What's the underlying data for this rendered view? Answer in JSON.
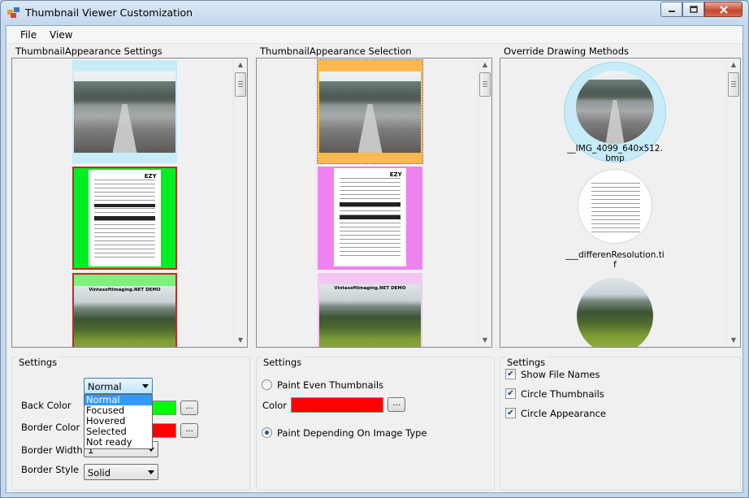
{
  "window": {
    "title": "Thumbnail Viewer Customization"
  },
  "menu": {
    "file": "File",
    "view": "View"
  },
  "panels": {
    "left": {
      "title": "ThumbnailAppearance Settings"
    },
    "middle": {
      "title": "ThumbnailAppearance Selection"
    },
    "right": {
      "title": "Override Drawing Methods"
    }
  },
  "thumbnails": {
    "doc_tag": "EZY",
    "landscape_caption": "VintasoftImaging.NET DEMO",
    "file1": "__IMG_4099_640x512.",
    "file1_ext": "bmp",
    "file2": "___differenResolution.ti",
    "file2_ext": "f"
  },
  "left_settings": {
    "title": "Settings",
    "appearance_select": "Normal",
    "appearance_options": [
      "Normal",
      "Focused",
      "Hovered",
      "Selected",
      "Not ready"
    ],
    "back_color_label": "Back Color",
    "border_color_label": "Border Color",
    "border_width_label": "Border Width",
    "border_width_value": "1",
    "border_style_label": "Border Style",
    "border_style_value": "Solid",
    "ellipsis": "..."
  },
  "middle_settings": {
    "title": "Settings",
    "paint_even_label": "Paint Even Thumbnails",
    "color_label": "Color",
    "paint_type_label": "Paint Depending On Image Type",
    "ellipsis": "..."
  },
  "right_settings": {
    "title": "Settings",
    "show_file_names": "Show File Names",
    "circle_thumbnails": "Circle Thumbnails",
    "circle_appearance": "Circle Appearance"
  },
  "colors": {
    "back_color": "#00ff00",
    "border_color": "#ff0000",
    "even_color": "#ff0000",
    "normal_bg": "#c7ecf7",
    "selected_bg": "#ffb84d",
    "focused_frame": "#c22a2a",
    "green_bg": "#00ee22",
    "pink_bg": "#ee82ee"
  }
}
